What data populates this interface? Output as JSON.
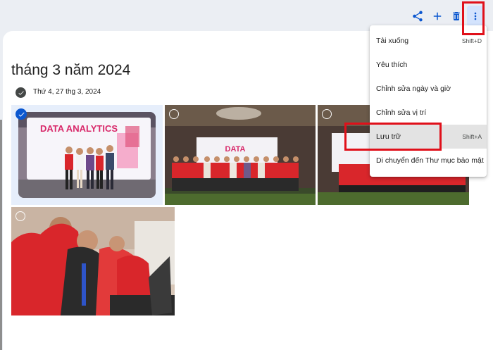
{
  "toolbar": {
    "share_icon": "share-icon",
    "add_icon": "add-icon",
    "delete_icon": "delete-icon",
    "more_icon": "more-vert-icon"
  },
  "library": {
    "month_title": "tháng 3 năm 2024",
    "day_label": "Thứ 4, 27 thg 3, 2024"
  },
  "photos": [
    {
      "id": "photo-1",
      "selected": true,
      "banner_text": "DATA ANALYTICS"
    },
    {
      "id": "photo-2",
      "selected": false,
      "banner_text": "DATA"
    },
    {
      "id": "photo-3",
      "selected": false
    },
    {
      "id": "photo-4",
      "selected": false
    }
  ],
  "menu": {
    "items": [
      {
        "label": "Tải xuống",
        "shortcut": "Shift+D"
      },
      {
        "label": "Yêu thích",
        "shortcut": ""
      },
      {
        "label": "Chỉnh sửa ngày và giờ",
        "shortcut": ""
      },
      {
        "label": "Chỉnh sửa vị trí",
        "shortcut": ""
      },
      {
        "label": "Lưu trữ",
        "shortcut": "Shift+A"
      },
      {
        "label": "Di chuyển đến Thư mục bảo mật",
        "shortcut": ""
      }
    ]
  },
  "colors": {
    "accent": "#0b57d0",
    "highlight": "#e0101a",
    "background": "#ebeef3"
  }
}
